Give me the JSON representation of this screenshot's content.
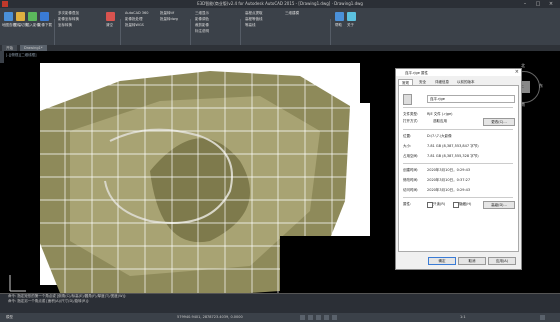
{
  "window": {
    "title": "E3D智能(商业版)v2.4 for Autodesk AutoCAD 2015 - [Drawing1.dwg] · Drawing1.dwg"
  },
  "ribbon": {
    "panels": [
      {
        "label": "缩放/平移"
      },
      {
        "label": "地块/图层"
      },
      {
        "label": "矢量影像"
      },
      {
        "label": "辅助/工具"
      },
      {
        "label": "1:1万/地形"
      },
      {
        "label": "帮助/关于"
      }
    ],
    "buttons": [
      "地图查看",
      "图幅切换",
      "插入影像",
      "影像下载",
      "多次影像叠加",
      "影像坐标转换",
      "坐标转换",
      "清空",
      "AutoCAD 360",
      "影像批处理",
      "批量转WGS",
      "批量转tif",
      "批量转dwg",
      "三维显示",
      "影像调色",
      "裁剪影像",
      "标注说明",
      "高程点提取",
      "高程等值线",
      "等高线",
      "三维建模",
      "帮助",
      "关于"
    ]
  },
  "doc_tabs": [
    "开始",
    "Drawing1*"
  ],
  "viewport_label": "[-][俯视][二维线框]",
  "compass": {
    "n": "北",
    "s": "南",
    "e": "东",
    "w": "西",
    "top": "上"
  },
  "command_line": [
    "命令: 指定矩形的第一个角点或 [倒角(C)/标高(E)/圆角(F)/厚度(T)/宽度(W)]:",
    "命令: 指定另一个角点或 [面积(A)/尺寸(D)/旋转(R)]:"
  ],
  "status": {
    "coords": "579940.9401, 2878723.4039, 0.0000",
    "mode": "模型",
    "scale": "1:1"
  },
  "dialog": {
    "title": "连平.rjge 属性",
    "tabs": [
      "常规",
      "安全",
      "详细信息",
      "以前的版本"
    ],
    "filename": "连平.rjge",
    "file_type_label": "文件类型:",
    "file_type_value": "RJE 文件 (.rjge)",
    "opens_with_label": "打开方式:",
    "opens_with_value": "选取应用",
    "change_button": "更改(C)...",
    "location_label": "位置:",
    "location_value": "D:\\7.\\7.\\大影像",
    "size_label": "大小:",
    "size_value": "7.81 GB (8,387,553,847 字节)",
    "disk_size_label": "占用空间:",
    "disk_size_value": "7.81 GB (8,387,555,328 字节)",
    "created_label": "创建时间:",
    "created_value": "2020年3月10日，0:29:43",
    "modified_label": "修改时间:",
    "modified_value": "2020年3月10日，0:37:27",
    "accessed_label": "访问时间:",
    "accessed_value": "2020年3月10日，0:29:43",
    "attributes_label": "属性:",
    "readonly_label": "只读(R)",
    "hidden_label": "隐藏(H)",
    "advanced_button": "高级(D)...",
    "ok_button": "确定",
    "cancel_button": "取消",
    "apply_button": "应用(A)"
  }
}
